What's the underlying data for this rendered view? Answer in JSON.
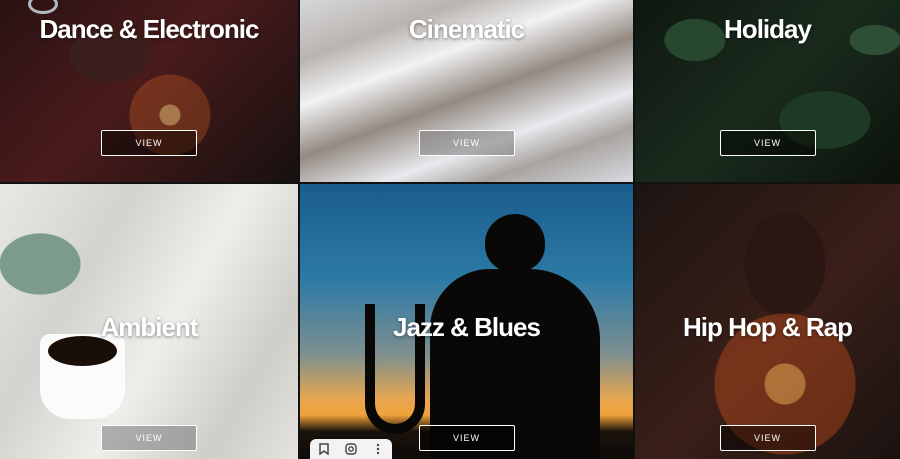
{
  "tiles": [
    {
      "title": "Dance & Electronic",
      "button": "VIEW"
    },
    {
      "title": "Cinematic",
      "button": "VIEW"
    },
    {
      "title": "Holiday",
      "button": "VIEW"
    },
    {
      "title": "Ambient",
      "button": "VIEW"
    },
    {
      "title": "Jazz & Blues",
      "button": "VIEW"
    },
    {
      "title": "Hip Hop & Rap",
      "button": "VIEW"
    }
  ],
  "toolbar": {
    "icons": [
      "bookmark-icon",
      "lens-icon",
      "more-vertical-icon"
    ]
  }
}
